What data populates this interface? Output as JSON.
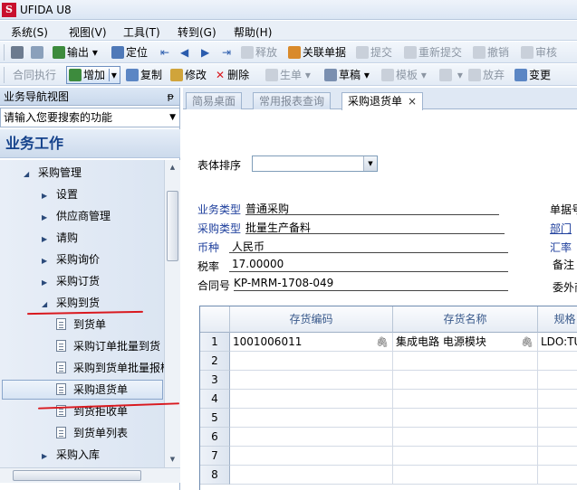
{
  "app": {
    "title": "UFIDA U8",
    "logo": "U8"
  },
  "menu": [
    "系统(S)",
    "视图(V)",
    "工具(T)",
    "转到(G)",
    "帮助(H)"
  ],
  "toolbar1": [
    {
      "label": "",
      "icon": "printer-icon"
    },
    {
      "label": "",
      "icon": "print-preview-icon"
    },
    {
      "label": "输出",
      "icon": "export-icon"
    },
    {
      "label": "定位",
      "icon": "locate-icon"
    },
    {
      "label": "释放",
      "icon": "release-icon"
    },
    {
      "label": "关联单据",
      "icon": "link-icon"
    },
    {
      "label": "提交",
      "icon": "submit-icon"
    },
    {
      "label": "重新提交",
      "icon": "resubmit-icon"
    },
    {
      "label": "撤销",
      "icon": "undo-icon"
    },
    {
      "label": "审核",
      "icon": "approve-icon"
    }
  ],
  "toolbar2": [
    {
      "label": "合同执行"
    },
    {
      "label": "增加",
      "icon": "add-icon"
    },
    {
      "label": "复制",
      "icon": "copy-icon"
    },
    {
      "label": "修改",
      "icon": "edit-icon"
    },
    {
      "label": "删除",
      "icon": "delete-icon"
    },
    {
      "label": "生单",
      "icon": "generate-icon"
    },
    {
      "label": "草稿",
      "icon": "draft-icon"
    },
    {
      "label": "模板",
      "icon": "template-icon"
    },
    {
      "label": "",
      "icon": "save-icon"
    },
    {
      "label": "放弃",
      "icon": "discard-icon"
    },
    {
      "label": "变更",
      "icon": "change-icon"
    }
  ],
  "nav": {
    "header": "业务导航视图",
    "pin": "ᵽ",
    "search_placeholder": "请输入您要搜索的功能",
    "section": "业务工作",
    "tree": [
      {
        "label": "采购管理",
        "level": 0,
        "type": "expanded"
      },
      {
        "label": "设置",
        "level": 1,
        "type": "collapsed"
      },
      {
        "label": "供应商管理",
        "level": 1,
        "type": "collapsed"
      },
      {
        "label": "请购",
        "level": 1,
        "type": "collapsed"
      },
      {
        "label": "采购询价",
        "level": 1,
        "type": "collapsed"
      },
      {
        "label": "采购订货",
        "level": 1,
        "type": "collapsed"
      },
      {
        "label": "采购到货",
        "level": 1,
        "type": "expanded"
      },
      {
        "label": "到货单",
        "level": 2,
        "type": "doc"
      },
      {
        "label": "采购订单批量到货",
        "level": 2,
        "type": "doc"
      },
      {
        "label": "采购到货单批量报检",
        "level": 2,
        "type": "doc"
      },
      {
        "label": "采购退货单",
        "level": 2,
        "type": "doc",
        "selected": true
      },
      {
        "label": "到货拒收单",
        "level": 2,
        "type": "doc"
      },
      {
        "label": "到货单列表",
        "level": 2,
        "type": "doc"
      },
      {
        "label": "采购入库",
        "level": 1,
        "type": "collapsed"
      }
    ]
  },
  "tabs": [
    {
      "label": "简易桌面",
      "active": false
    },
    {
      "label": "常用报表查询",
      "active": false
    },
    {
      "label": "采购退货单",
      "active": true,
      "close": "×"
    }
  ],
  "form": {
    "sort_label": "表体排序",
    "sort_value": "",
    "fields": {
      "business_type_label": "业务类型",
      "business_type_value": "普通采购",
      "purchase_type_label": "采购类型",
      "purchase_type_value": "批量生产备料",
      "currency_label": "币种",
      "currency_value": "人民币",
      "tax_rate_label": "税率",
      "tax_rate_value": "17.00000",
      "contract_label": "合同号",
      "contract_value": "KP-MRM-1708-049",
      "doc_no_label": "单据号",
      "department_label": "部门",
      "exchange_rate_label": "汇率",
      "remark_label": "备注",
      "outsource_label": "委外商"
    }
  },
  "grid": {
    "columns": [
      "存货编码",
      "存货名称",
      "规格"
    ],
    "rows": [
      {
        "n": "1",
        "code": "1001006011",
        "name": "集成电路 电源模块",
        "spec": "LDO:TU"
      },
      {
        "n": "2",
        "code": "",
        "name": "",
        "spec": ""
      },
      {
        "n": "3",
        "code": "",
        "name": "",
        "spec": ""
      },
      {
        "n": "4",
        "code": "",
        "name": "",
        "spec": ""
      },
      {
        "n": "5",
        "code": "",
        "name": "",
        "spec": ""
      },
      {
        "n": "6",
        "code": "",
        "name": "",
        "spec": ""
      },
      {
        "n": "7",
        "code": "",
        "name": "",
        "spec": ""
      },
      {
        "n": "8",
        "code": "",
        "name": "",
        "spec": ""
      }
    ]
  }
}
